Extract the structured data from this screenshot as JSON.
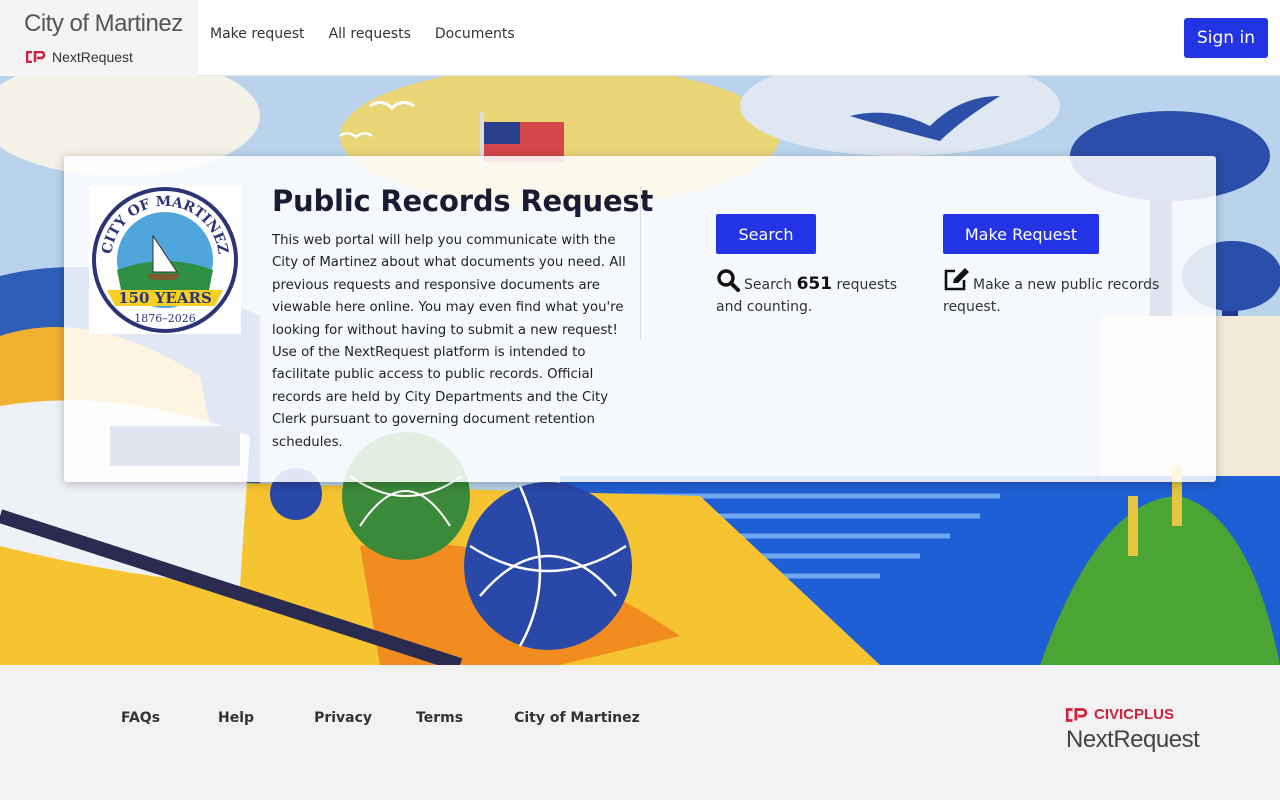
{
  "header": {
    "city_name": "City of Martinez",
    "product_name": "NextRequest",
    "nav": [
      "Make request",
      "All requests",
      "Documents"
    ],
    "signin_label": "Sign in"
  },
  "card": {
    "seal": {
      "top_text": "CITY OF MARTINEZ",
      "anniversary": "150 YEARS",
      "years": "1876–2026"
    },
    "title": "Public Records Request",
    "description": "This web portal will help you communicate with the City of Martinez about what documents you need. All previous requests and responsive documents are viewable here online. You may even find what you're looking for without having to submit a new request!  Use of the NextRequest platform is intended to facilitate public access to public records. Official records are held by City Departments and the City Clerk pursuant to governing document retention schedules.",
    "search": {
      "button": "Search",
      "prefix": "Search",
      "count": "651",
      "suffix": "requests and counting.",
      "icon": "search-icon"
    },
    "make_request": {
      "button": "Make Request",
      "text": "Make a new public records request.",
      "icon": "edit-icon"
    }
  },
  "footer": {
    "links": [
      "FAQs",
      "Help",
      "Privacy",
      "Terms",
      "City of Martinez"
    ],
    "brand_top": "CIVICPLUS",
    "brand_bottom": "NextRequest"
  },
  "colors": {
    "accent": "#2234e6",
    "brand_red": "#d0213b"
  }
}
